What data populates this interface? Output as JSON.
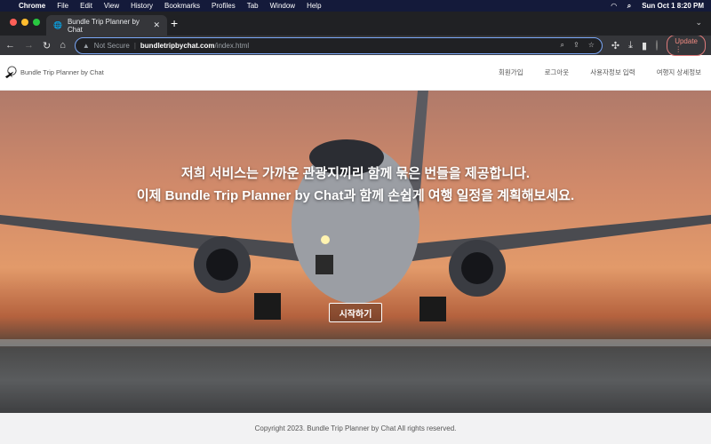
{
  "menubar": {
    "items": [
      "Chrome",
      "File",
      "Edit",
      "View",
      "History",
      "Bookmarks",
      "Profiles",
      "Tab",
      "Window",
      "Help"
    ],
    "clock": "Sun Oct 1  8:20 PM"
  },
  "browser": {
    "tab_title": "Bundle Trip Planner by Chat",
    "not_secure": "Not Secure",
    "url_domain": "bundletripbychat.com",
    "url_path": "/index.html",
    "update_label": "Update"
  },
  "site": {
    "brand": "Bundle Trip Planner by Chat",
    "nav": [
      "회원가입",
      "로그아웃",
      "사용자정보 입력",
      "여행지 상세정보"
    ]
  },
  "hero": {
    "line1": "저희 서비스는 가까운 관광지끼리 함께 묶은 번들을 제공합니다.",
    "line2": "이제 Bundle Trip Planner by Chat과 함께 손쉽게 여행 일정을 계획해보세요.",
    "cta": "시작하기"
  },
  "footer": {
    "text": "Copyright 2023. Bundle Trip Planner by Chat All rights reserved."
  }
}
